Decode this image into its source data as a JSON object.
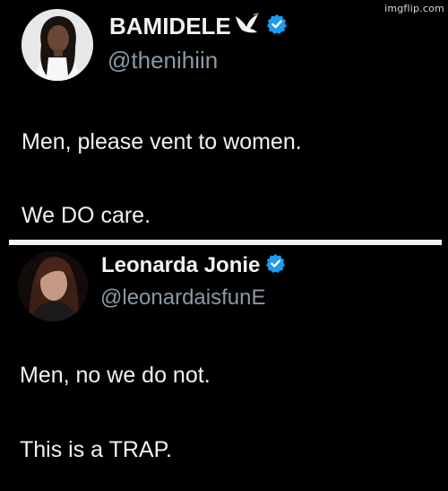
{
  "watermark": "imgflip.com",
  "tweets": [
    {
      "display_name": "BAMIDELE",
      "emoji_icon": "dove-emoji",
      "verified": true,
      "handle": "@thenihiin",
      "lines": [
        "Men, please vent to women.",
        "We DO care."
      ]
    },
    {
      "display_name": "Leonarda Jonie",
      "verified": true,
      "handle": "@leonardaisfunE",
      "lines": [
        "Men, no we do not.",
        "This is a TRAP."
      ]
    }
  ],
  "colors": {
    "background": "#000000",
    "text": "#f1f1f1",
    "handle": "#8b98a5",
    "verified": "#1d9bf0",
    "divider": "#f2f2f2"
  }
}
